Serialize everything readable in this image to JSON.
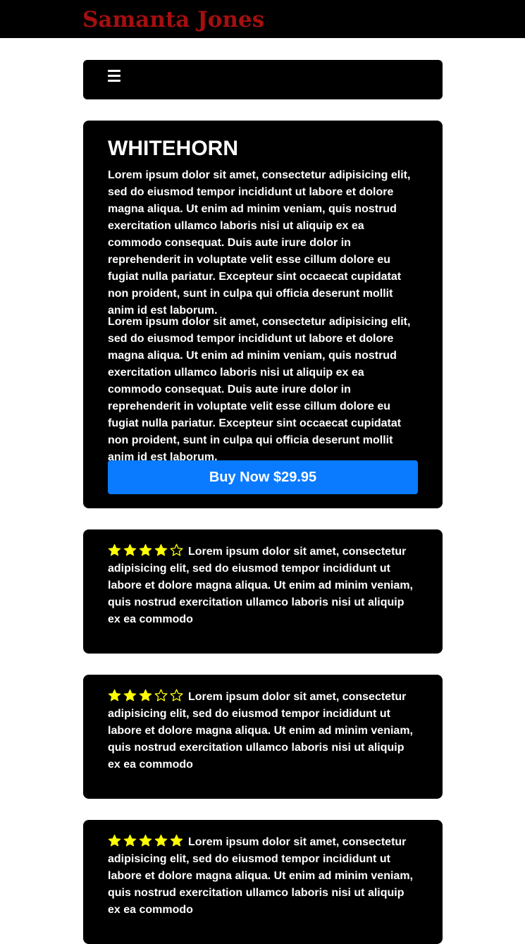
{
  "header": {
    "brand": "Samanta Jones",
    "brand_color": "#a50f0f"
  },
  "nav": {
    "menu_icon": "hamburger-menu-icon"
  },
  "product": {
    "title": "WHITEHORN",
    "paragraphs": [
      "Lorem ipsum dolor sit amet, consectetur adipisicing elit, sed do eiusmod tempor incididunt ut labore et dolore magna aliqua. Ut enim ad minim veniam, quis nostrud exercitation ullamco laboris nisi ut aliquip ex ea commodo consequat. Duis aute irure dolor in reprehenderit in voluptate velit esse cillum dolore eu fugiat nulla pariatur. Excepteur sint occaecat cupidatat non proident, sunt in culpa qui officia deserunt mollit anim id est laborum.",
      "Lorem ipsum dolor sit amet, consectetur adipisicing elit, sed do eiusmod tempor incididunt ut labore et dolore magna aliqua. Ut enim ad minim veniam, quis nostrud exercitation ullamco laboris nisi ut aliquip ex ea commodo consequat. Duis aute irure dolor in reprehenderit in voluptate velit esse cillum dolore eu fugiat nulla pariatur. Excepteur sint occaecat cupidatat non proident, sunt in culpa qui officia deserunt mollit anim id est laborum."
    ],
    "buy_label": "Buy Now $29.95",
    "buy_color": "#0a7bff"
  },
  "reviews": [
    {
      "rating": 4,
      "max_rating": 5,
      "text": "Lorem ipsum dolor sit amet, consectetur adipisicing elit, sed do eiusmod tempor incididunt ut labore et dolore magna aliqua. Ut enim ad minim veniam, quis nostrud exercitation ullamco laboris nisi ut aliquip ex ea commodo"
    },
    {
      "rating": 3,
      "max_rating": 5,
      "text": "Lorem ipsum dolor sit amet, consectetur adipisicing elit, sed do eiusmod tempor incididunt ut labore et dolore magna aliqua. Ut enim ad minim veniam, quis nostrud exercitation ullamco laboris nisi ut aliquip ex ea commodo"
    },
    {
      "rating": 5,
      "max_rating": 5,
      "text": "Lorem ipsum dolor sit amet, consectetur adipisicing elit, sed do eiusmod tempor incididunt ut labore et dolore magna aliqua. Ut enim ad minim veniam, quis nostrud exercitation ullamco laboris nisi ut aliquip ex ea commodo"
    }
  ],
  "colors": {
    "star": "#ffff00",
    "card_background": "#000000",
    "text": "#ffffff"
  },
  "icons": {
    "filled_star": "star-filled-icon",
    "empty_star": "star-outline-icon"
  }
}
